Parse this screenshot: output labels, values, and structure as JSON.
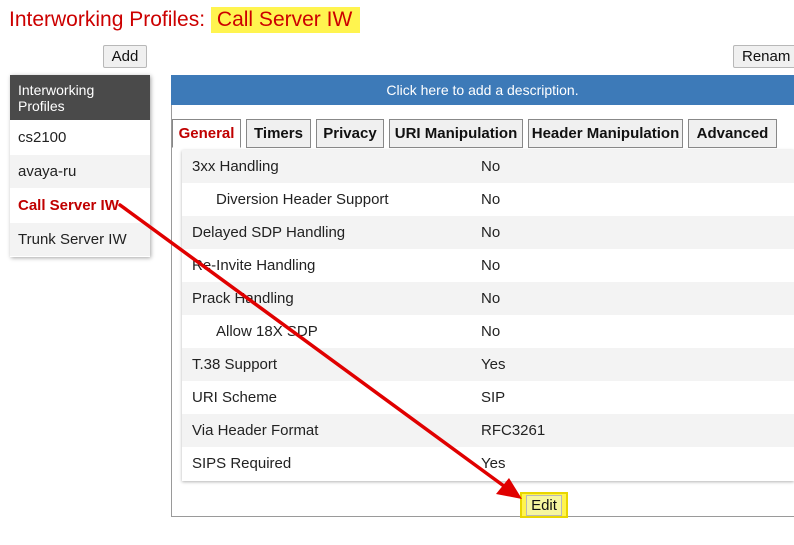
{
  "page": {
    "title_prefix": "Interworking Profiles:",
    "title_highlight": "Call Server IW"
  },
  "toolbar": {
    "add_label": "Add",
    "rename_label": "Renam"
  },
  "sidebar": {
    "header": "Interworking Profiles",
    "items": [
      {
        "label": "cs2100"
      },
      {
        "label": "avaya-ru"
      },
      {
        "label": "Call Server IW"
      },
      {
        "label": "Trunk Server IW"
      }
    ]
  },
  "description": {
    "text": "Click here to add a description."
  },
  "tabs": [
    {
      "label": "General"
    },
    {
      "label": "Timers"
    },
    {
      "label": "Privacy"
    },
    {
      "label": "URI Manipulation"
    },
    {
      "label": "Header Manipulation"
    },
    {
      "label": "Advanced"
    }
  ],
  "general": {
    "rows": [
      {
        "label": "3xx Handling",
        "value": "No"
      },
      {
        "label": "Diversion Header Support",
        "value": "No"
      },
      {
        "label": "Delayed SDP Handling",
        "value": "No"
      },
      {
        "label": "Re-Invite Handling",
        "value": "No"
      },
      {
        "label": "Prack Handling",
        "value": "No"
      },
      {
        "label": "Allow 18X SDP",
        "value": "No"
      },
      {
        "label": "T.38 Support",
        "value": "Yes"
      },
      {
        "label": "URI Scheme",
        "value": "SIP"
      },
      {
        "label": "Via Header Format",
        "value": "RFC3261"
      },
      {
        "label": "SIPS Required",
        "value": "Yes"
      }
    ]
  },
  "actions": {
    "edit_label": "Edit"
  },
  "colors": {
    "accent_red": "#cc0000",
    "highlight_yellow": "#fff44f",
    "desc_blue": "#3d7ab8",
    "annotation_arrow": "#e00000"
  }
}
